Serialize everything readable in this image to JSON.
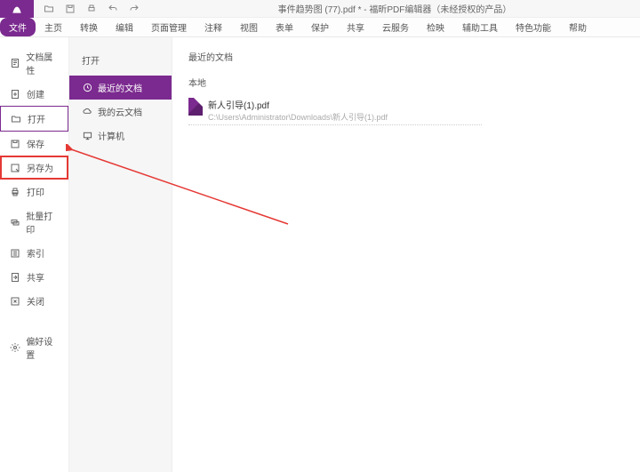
{
  "titlebar": {
    "title": "事件趋势图 (77).pdf * - 福昕PDF编辑器（未经授权的产品）"
  },
  "ribbon": {
    "tabs": [
      "文件",
      "主页",
      "转换",
      "编辑",
      "页面管理",
      "注释",
      "视图",
      "表单",
      "保护",
      "共享",
      "云服务",
      "检映",
      "辅助工具",
      "特色功能",
      "帮助"
    ],
    "activeIndex": 0
  },
  "sidebar": {
    "items": [
      {
        "label": "文档属性"
      },
      {
        "label": "创建"
      },
      {
        "label": "打开"
      },
      {
        "label": "保存"
      },
      {
        "label": "另存为"
      },
      {
        "label": "打印"
      },
      {
        "label": "批量打印"
      },
      {
        "label": "索引"
      },
      {
        "label": "共享"
      },
      {
        "label": "关闭"
      }
    ],
    "prefs": {
      "label": "偏好设置"
    }
  },
  "subpanel": {
    "title": "打开",
    "items": [
      {
        "label": "最近的文档"
      },
      {
        "label": "我的云文档"
      },
      {
        "label": "计算机"
      }
    ],
    "activeIndex": 0
  },
  "main": {
    "title": "最近的文档",
    "section": "本地",
    "file": {
      "name": "新人引导(1).pdf",
      "path": "C:\\Users\\Administrator\\Downloads\\新人引导(1).pdf"
    }
  }
}
